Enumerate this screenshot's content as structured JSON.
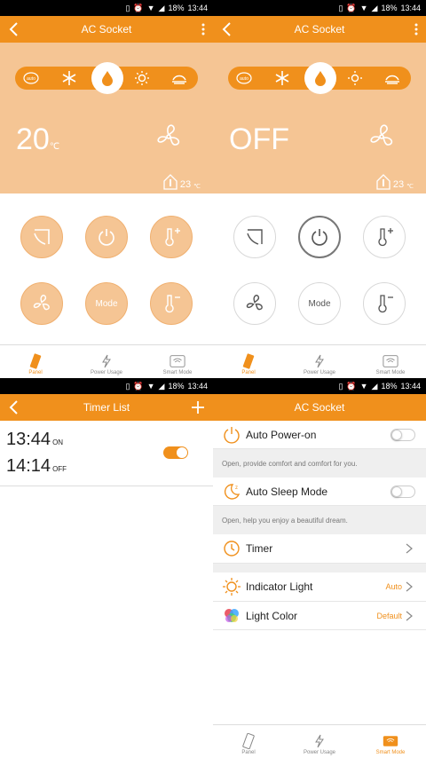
{
  "status_bar": {
    "battery": "18%",
    "time": "13:44"
  },
  "panel_screen": {
    "title": "AC Socket",
    "modes": [
      "auto-mode-icon",
      "snowflake-icon",
      "drop-icon",
      "sun-icon",
      "dry-icon"
    ],
    "selected_mode": "drop-icon",
    "temperature_on": {
      "value": "20",
      "unit": "℃"
    },
    "temperature_off": "OFF",
    "room_temp": {
      "value": "23",
      "unit": "℃"
    },
    "controls": {
      "mode_label": "Mode"
    }
  },
  "nav": {
    "panel": "Panel",
    "power_usage": "Power Usage",
    "smart_mode": "Smart Mode"
  },
  "timer_list": {
    "title": "Timer List",
    "on_time": "13:44",
    "on_label": "ON",
    "off_time": "14:14",
    "off_label": "OFF",
    "enabled": true
  },
  "smart_mode": {
    "title": "AC Socket",
    "auto_power_on": {
      "label": "Auto Power-on",
      "desc": "Open, provide comfort and comfort for you.",
      "enabled": false
    },
    "auto_sleep": {
      "label": "Auto Sleep Mode",
      "desc": "Open, help you enjoy a beautiful dream.",
      "enabled": false
    },
    "timer": {
      "label": "Timer"
    },
    "indicator_light": {
      "label": "Indicator Light",
      "value": "Auto"
    },
    "light_color": {
      "label": "Light Color",
      "value": "Default"
    }
  },
  "colors": {
    "accent": "#f0901c",
    "hero": "#f5c594"
  }
}
